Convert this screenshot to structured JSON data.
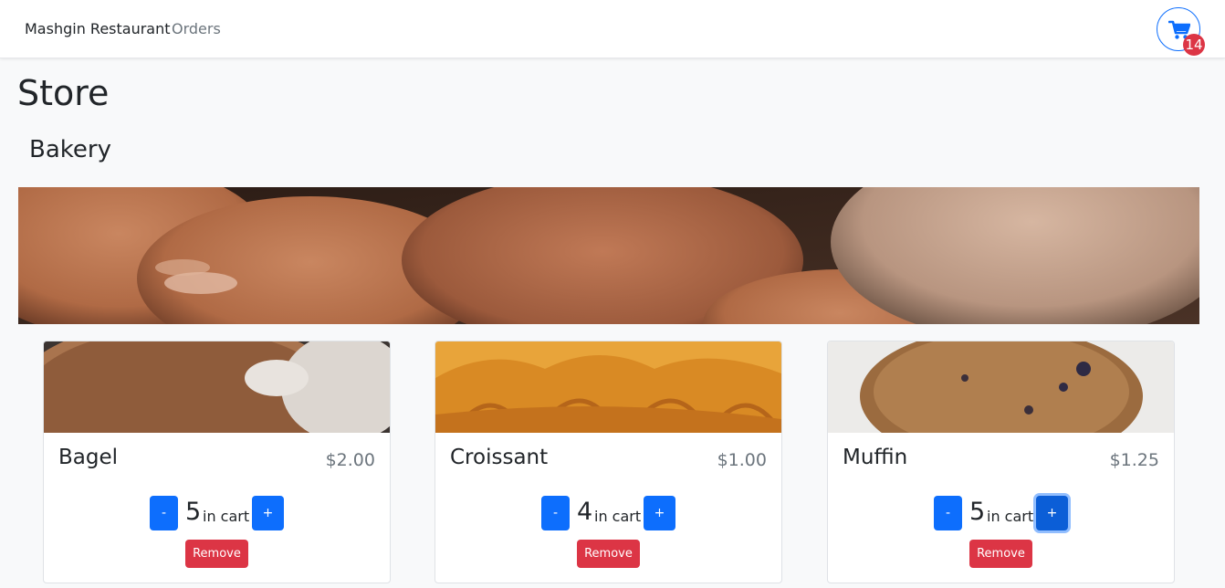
{
  "navbar": {
    "brand": "Mashgin Restaurant",
    "links": [
      "Orders"
    ],
    "cart_icon": "cart-icon",
    "cart_count": "14"
  },
  "page": {
    "title": "Store",
    "section": "Bakery"
  },
  "products": [
    {
      "name": "Bagel",
      "price": "$2.00",
      "qty": "5",
      "qty_label": "in cart",
      "minus": "-",
      "plus": "+",
      "remove": "Remove"
    },
    {
      "name": "Croissant",
      "price": "$1.00",
      "qty": "4",
      "qty_label": "in cart",
      "minus": "-",
      "plus": "+",
      "remove": "Remove"
    },
    {
      "name": "Muffin",
      "price": "$1.25",
      "qty": "5",
      "qty_label": "in cart",
      "minus": "-",
      "plus": "+",
      "remove": "Remove"
    }
  ],
  "colors": {
    "primary": "#0d6efd",
    "danger": "#dc3545",
    "muted": "#6c757d",
    "background": "#f8f9fa"
  }
}
